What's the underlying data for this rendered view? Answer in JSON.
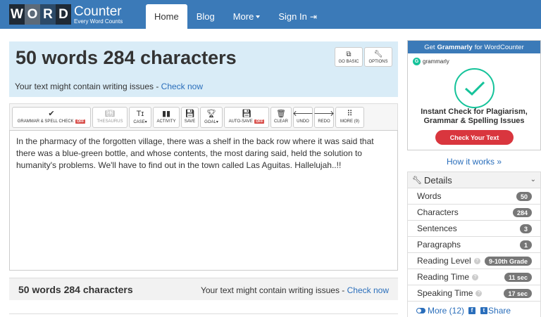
{
  "logo": {
    "letters": [
      "W",
      "O",
      "R",
      "D"
    ],
    "name": "Counter",
    "tagline": "Every Word Counts"
  },
  "nav": {
    "home": "Home",
    "blog": "Blog",
    "more": "More",
    "signin": "Sign In"
  },
  "banner": {
    "title": "50 words 284 characters",
    "issue_text": "Your text might contain writing issues - ",
    "issue_link": "Check now",
    "go_basic": "GO BASIC",
    "options": "OPTIONS"
  },
  "toolbar": {
    "grammar": "GRAMMAR & SPELL CHECK",
    "grammar_state": "OFF",
    "thesaurus": "THESAURUS",
    "case": "CASE",
    "activity": "ACTIVITY",
    "save": "SAVE",
    "goal": "GOAL",
    "autosave": "AUTO-SAVE",
    "autosave_state": "OFF",
    "clear": "CLEAR",
    "undo": "UNDO",
    "redo": "REDO",
    "more": "MORE (9)"
  },
  "editor": {
    "text": "In the pharmacy of the forgotten village, there was a shelf in the back row where it was said that there was a blue-green bottle, and whose contents, the most daring said, held the solution to humanity's problems. We'll have to find out in the town called Las Aguitas.  Hallelujah..!!"
  },
  "bottom": {
    "count": "50 words 284 characters",
    "issue_text": "Your text might contain writing issues - ",
    "issue_link": "Check now"
  },
  "ad": {
    "head_pre": "Get",
    "head_brand": "Grammarly",
    "head_post": "for WordCounter",
    "brand": "grammarly",
    "text_line1": "Instant Check for Plagiarism,",
    "text_line2": "Grammar & Spelling Issues",
    "button": "Check Your Text"
  },
  "how_it_works": "How it works »",
  "details": {
    "title": "Details",
    "rows": [
      {
        "label": "Words",
        "value": "50"
      },
      {
        "label": "Characters",
        "value": "284"
      },
      {
        "label": "Sentences",
        "value": "3"
      },
      {
        "label": "Paragraphs",
        "value": "1"
      },
      {
        "label": "Reading Level",
        "value": "9-10th Grade"
      },
      {
        "label": "Reading Time",
        "value": "11 sec"
      },
      {
        "label": "Speaking Time",
        "value": "17 sec"
      }
    ],
    "more": "More (12)",
    "share": "Share"
  },
  "colors": {
    "nav_bg": "#3b7ab8",
    "banner_bg": "#d9ecf7",
    "link": "#2a6ebb",
    "off_badge": "#d9534f",
    "grammarly_green": "#15c39a",
    "ad_button": "#d9363e"
  }
}
